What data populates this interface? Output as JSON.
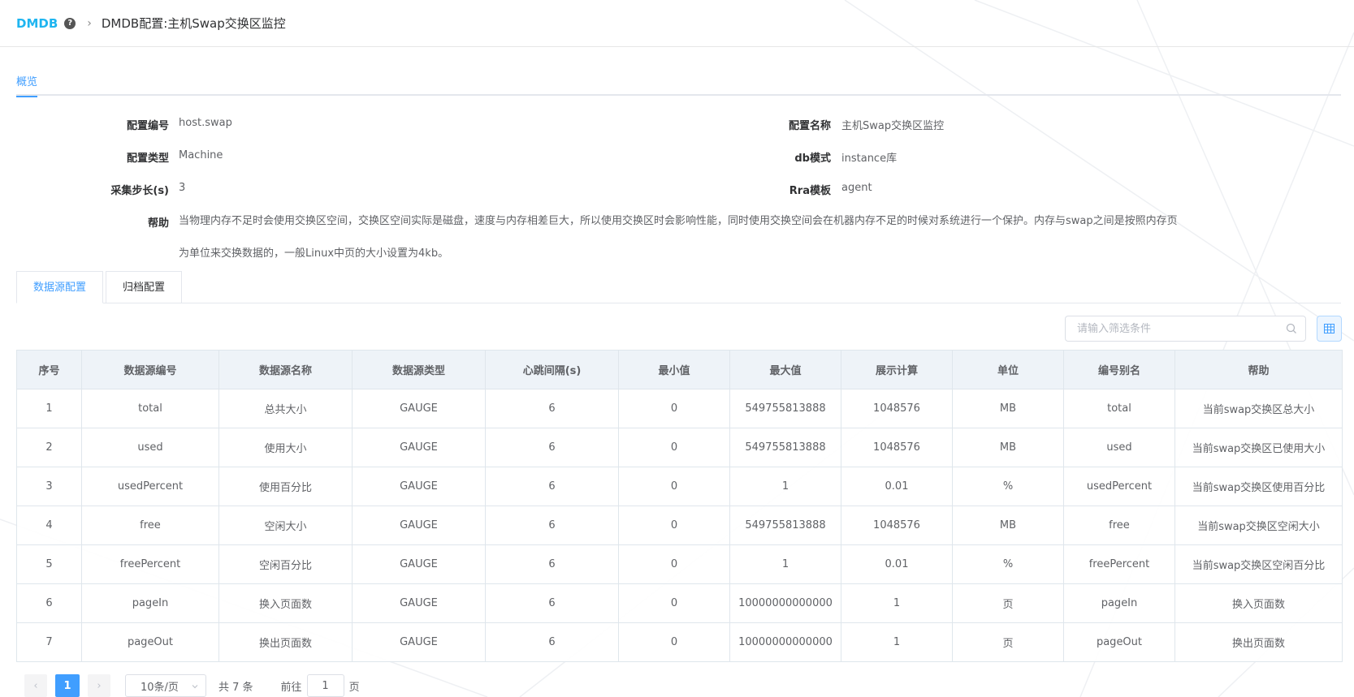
{
  "breadcrumb": {
    "brand": "DMDB",
    "title": "DMDB配置:主机Swap交换区监控"
  },
  "tabs": {
    "overview": "概览"
  },
  "details": {
    "config_id_label": "配置编号",
    "config_id": "host.swap",
    "config_name_label": "配置名称",
    "config_name": "主机Swap交换区监控",
    "config_type_label": "配置类型",
    "config_type": "Machine",
    "db_mode_label": "db模式",
    "db_mode": "instance库",
    "step_label": "采集步长(s)",
    "step": "3",
    "rra_label": "Rra模板",
    "rra": "agent",
    "help_label": "帮助",
    "help_line1": "当物理内存不足时会使用交换区空间，交换区空间实际是磁盘，速度与内存相差巨大，所以使用交换区时会影响性能，同时使用交换空间会在机器内存不足的时候对系统进行一个保护。内存与swap之间是按照内存页",
    "help_line2": "为单位来交换数据的，一般Linux中页的大小设置为4kb。"
  },
  "subtabs": {
    "datasource": "数据源配置",
    "archive": "归档配置"
  },
  "search": {
    "placeholder": "请输入筛选条件"
  },
  "table": {
    "headers": [
      "序号",
      "数据源编号",
      "数据源名称",
      "数据源类型",
      "心跳间隔(s)",
      "最小值",
      "最大值",
      "展示计算",
      "单位",
      "编号别名",
      "帮助"
    ],
    "rows": [
      [
        "1",
        "total",
        "总共大小",
        "GAUGE",
        "6",
        "0",
        "549755813888",
        "1048576",
        "MB",
        "total",
        "当前swap交换区总大小"
      ],
      [
        "2",
        "used",
        "使用大小",
        "GAUGE",
        "6",
        "0",
        "549755813888",
        "1048576",
        "MB",
        "used",
        "当前swap交换区已使用大小"
      ],
      [
        "3",
        "usedPercent",
        "使用百分比",
        "GAUGE",
        "6",
        "0",
        "1",
        "0.01",
        "%",
        "usedPercent",
        "当前swap交换区使用百分比"
      ],
      [
        "4",
        "free",
        "空闲大小",
        "GAUGE",
        "6",
        "0",
        "549755813888",
        "1048576",
        "MB",
        "free",
        "当前swap交换区空闲大小"
      ],
      [
        "5",
        "freePercent",
        "空闲百分比",
        "GAUGE",
        "6",
        "0",
        "1",
        "0.01",
        "%",
        "freePercent",
        "当前swap交换区空闲百分比"
      ],
      [
        "6",
        "pageIn",
        "换入页面数",
        "GAUGE",
        "6",
        "0",
        "10000000000000",
        "1",
        "页",
        "pageIn",
        "换入页面数"
      ],
      [
        "7",
        "pageOut",
        "换出页面数",
        "GAUGE",
        "6",
        "0",
        "10000000000000",
        "1",
        "页",
        "pageOut",
        "换出页面数"
      ]
    ]
  },
  "pagination": {
    "current_page": "1",
    "page_size": "10条/页",
    "total": "共 7 条",
    "goto_label": "前往",
    "goto_value": "1",
    "page_unit": "页"
  },
  "colors": {
    "brand": "#1fb5f0",
    "accent": "#409eff"
  }
}
